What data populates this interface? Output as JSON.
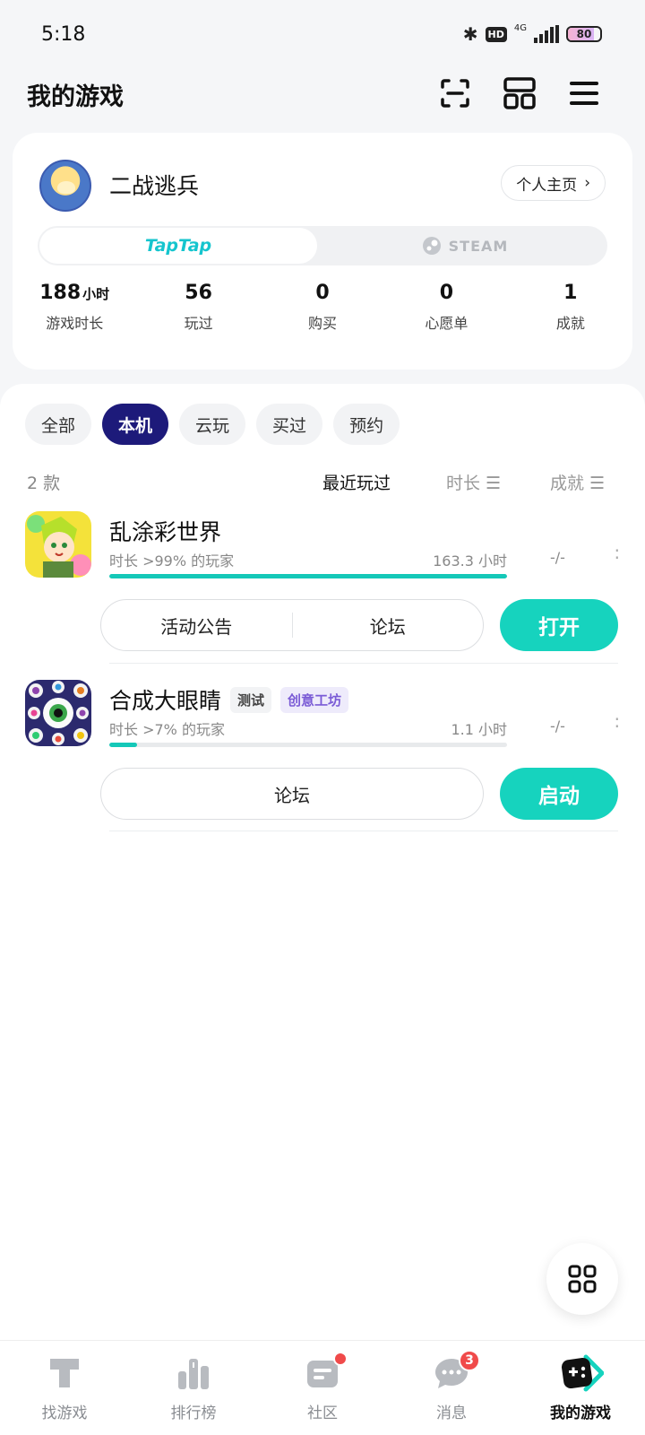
{
  "status_bar": {
    "time": "5:18",
    "hd": "HD",
    "network": "4G",
    "battery": "80"
  },
  "header": {
    "title": "我的游戏",
    "icons": [
      "scan-icon",
      "layout-icon",
      "menu-icon"
    ]
  },
  "profile": {
    "username": "二战逃兵",
    "homepage_label": "个人主页",
    "platform_tabs": [
      "TapTap",
      "STEAM"
    ],
    "active_platform": "TapTap",
    "stats": [
      {
        "value": "188",
        "unit": "小时",
        "label": "游戏时长"
      },
      {
        "value": "56",
        "unit": "",
        "label": "玩过"
      },
      {
        "value": "0",
        "unit": "",
        "label": "购买"
      },
      {
        "value": "0",
        "unit": "",
        "label": "心愿单"
      },
      {
        "value": "1",
        "unit": "",
        "label": "成就"
      }
    ]
  },
  "filters": {
    "items": [
      "全部",
      "本机",
      "云玩",
      "买过",
      "预约"
    ],
    "active": "本机"
  },
  "list_header": {
    "count": "2 款",
    "sort_recent": "最近玩过",
    "sort_time": "时长 ☰",
    "sort_achievement": "成就 ☰"
  },
  "games": [
    {
      "name": "乱涂彩世界",
      "tags": [],
      "percentile": "时长 >99% 的玩家",
      "hours": "163.3 小时",
      "achievement": "-/-",
      "progress": 1.0,
      "buttons": [
        "活动公告",
        "论坛"
      ],
      "action": "打开"
    },
    {
      "name": "合成大眼睛",
      "tags": [
        "测试",
        "创意工坊"
      ],
      "percentile": "时长 >7% 的玩家",
      "hours": "1.1 小时",
      "achievement": "-/-",
      "progress": 0.07,
      "buttons": [
        "论坛"
      ],
      "action": "启动"
    }
  ],
  "bottom_nav": {
    "items": [
      {
        "label": "找游戏",
        "icon": "taptap-icon"
      },
      {
        "label": "排行榜",
        "icon": "ranking-icon"
      },
      {
        "label": "社区",
        "icon": "community-icon",
        "dot": true
      },
      {
        "label": "消息",
        "icon": "message-icon",
        "badge": "3"
      },
      {
        "label": "我的游戏",
        "icon": "gamepad-icon"
      }
    ],
    "active": "我的游戏"
  },
  "colors": {
    "accent": "#16d3be",
    "active_chip": "#1d1a7a",
    "taptap": "#15c5ce",
    "badge": "#f04a4a"
  }
}
